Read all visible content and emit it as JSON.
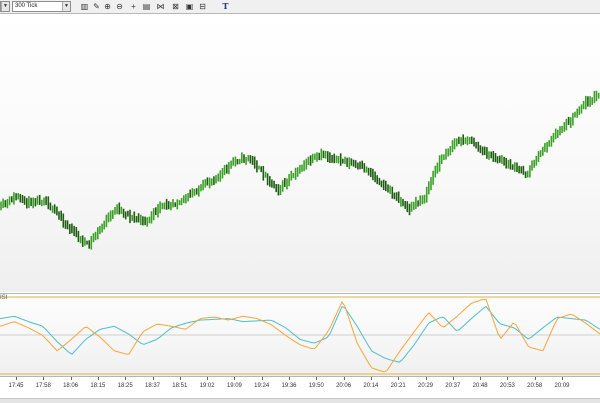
{
  "toolbar": {
    "instrument_value": "",
    "interval_value": "300 Tick",
    "buttons": [
      {
        "name": "bar-style-icon",
        "glyph": "▥"
      },
      {
        "name": "pencil-icon",
        "glyph": "✎"
      },
      {
        "name": "zoom-in-icon",
        "glyph": "⊕"
      },
      {
        "name": "zoom-out-icon",
        "glyph": "⊖"
      },
      {
        "name": "crosshair-icon",
        "glyph": "+"
      },
      {
        "name": "properties-icon",
        "glyph": "▤"
      },
      {
        "name": "indicators-icon",
        "glyph": "⋈"
      },
      {
        "name": "strategies-icon",
        "glyph": "⊠"
      },
      {
        "name": "clipboard-icon",
        "glyph": "▣"
      },
      {
        "name": "lock-icon",
        "glyph": "⊟"
      },
      {
        "name": "text-tool-icon",
        "glyph": "T"
      }
    ]
  },
  "indicator": {
    "label": "ISI"
  },
  "time_axis": {
    "labels": [
      "17:45",
      "17:58",
      "18:06",
      "18:15",
      "18:25",
      "18:37",
      "18:51",
      "19:02",
      "19:09",
      "19:24",
      "19:36",
      "19:50",
      "20:06",
      "20:14",
      "20:21",
      "20:29",
      "20:37",
      "20:48",
      "20:53",
      "20:58",
      "20:09"
    ]
  },
  "colors": {
    "candle_up": "#3aa126",
    "candle_down": "#1e5c12",
    "osc_teal": "#4bbfc8",
    "osc_orange": "#f5a53c",
    "level_line": "#e0b64a",
    "mid_line": "#cfcfcf"
  },
  "chart_data": {
    "type": "line",
    "series": [
      {
        "values": [
          188,
          178,
          183,
          180,
          196,
          212,
          225,
          205,
          188,
          198,
          201,
          187,
          183,
          176,
          166,
          156,
          143,
          139,
          156,
          170,
          158,
          143,
          137,
          141,
          145,
          151,
          163,
          177,
          190,
          177,
          143,
          126,
          121,
          134,
          141,
          148,
          155,
          133,
          116,
          102,
          86,
          78
        ]
      },
      {
        "values": [
          0.72,
          0.75,
          0.68,
          0.62,
          0.42,
          0.25,
          0.45,
          0.58,
          0.62,
          0.52,
          0.38,
          0.45,
          0.6,
          0.66,
          0.7,
          0.71,
          0.72,
          0.68,
          0.69,
          0.7,
          0.6,
          0.45,
          0.4,
          0.48,
          0.9,
          0.62,
          0.3,
          0.2,
          0.15,
          0.38,
          0.66,
          0.75,
          0.55,
          0.72,
          0.88,
          0.65,
          0.6,
          0.45,
          0.6,
          0.74,
          0.72,
          0.7,
          0.58
        ]
      },
      {
        "values": [
          0.62,
          0.68,
          0.6,
          0.5,
          0.3,
          0.45,
          0.62,
          0.48,
          0.3,
          0.25,
          0.55,
          0.65,
          0.62,
          0.58,
          0.72,
          0.74,
          0.7,
          0.75,
          0.72,
          0.64,
          0.5,
          0.38,
          0.32,
          0.56,
          0.96,
          0.4,
          0.08,
          0.02,
          0.3,
          0.55,
          0.8,
          0.6,
          0.75,
          0.92,
          0.98,
          0.45,
          0.68,
          0.35,
          0.3,
          0.72,
          0.78,
          0.66,
          0.52
        ]
      }
    ]
  }
}
